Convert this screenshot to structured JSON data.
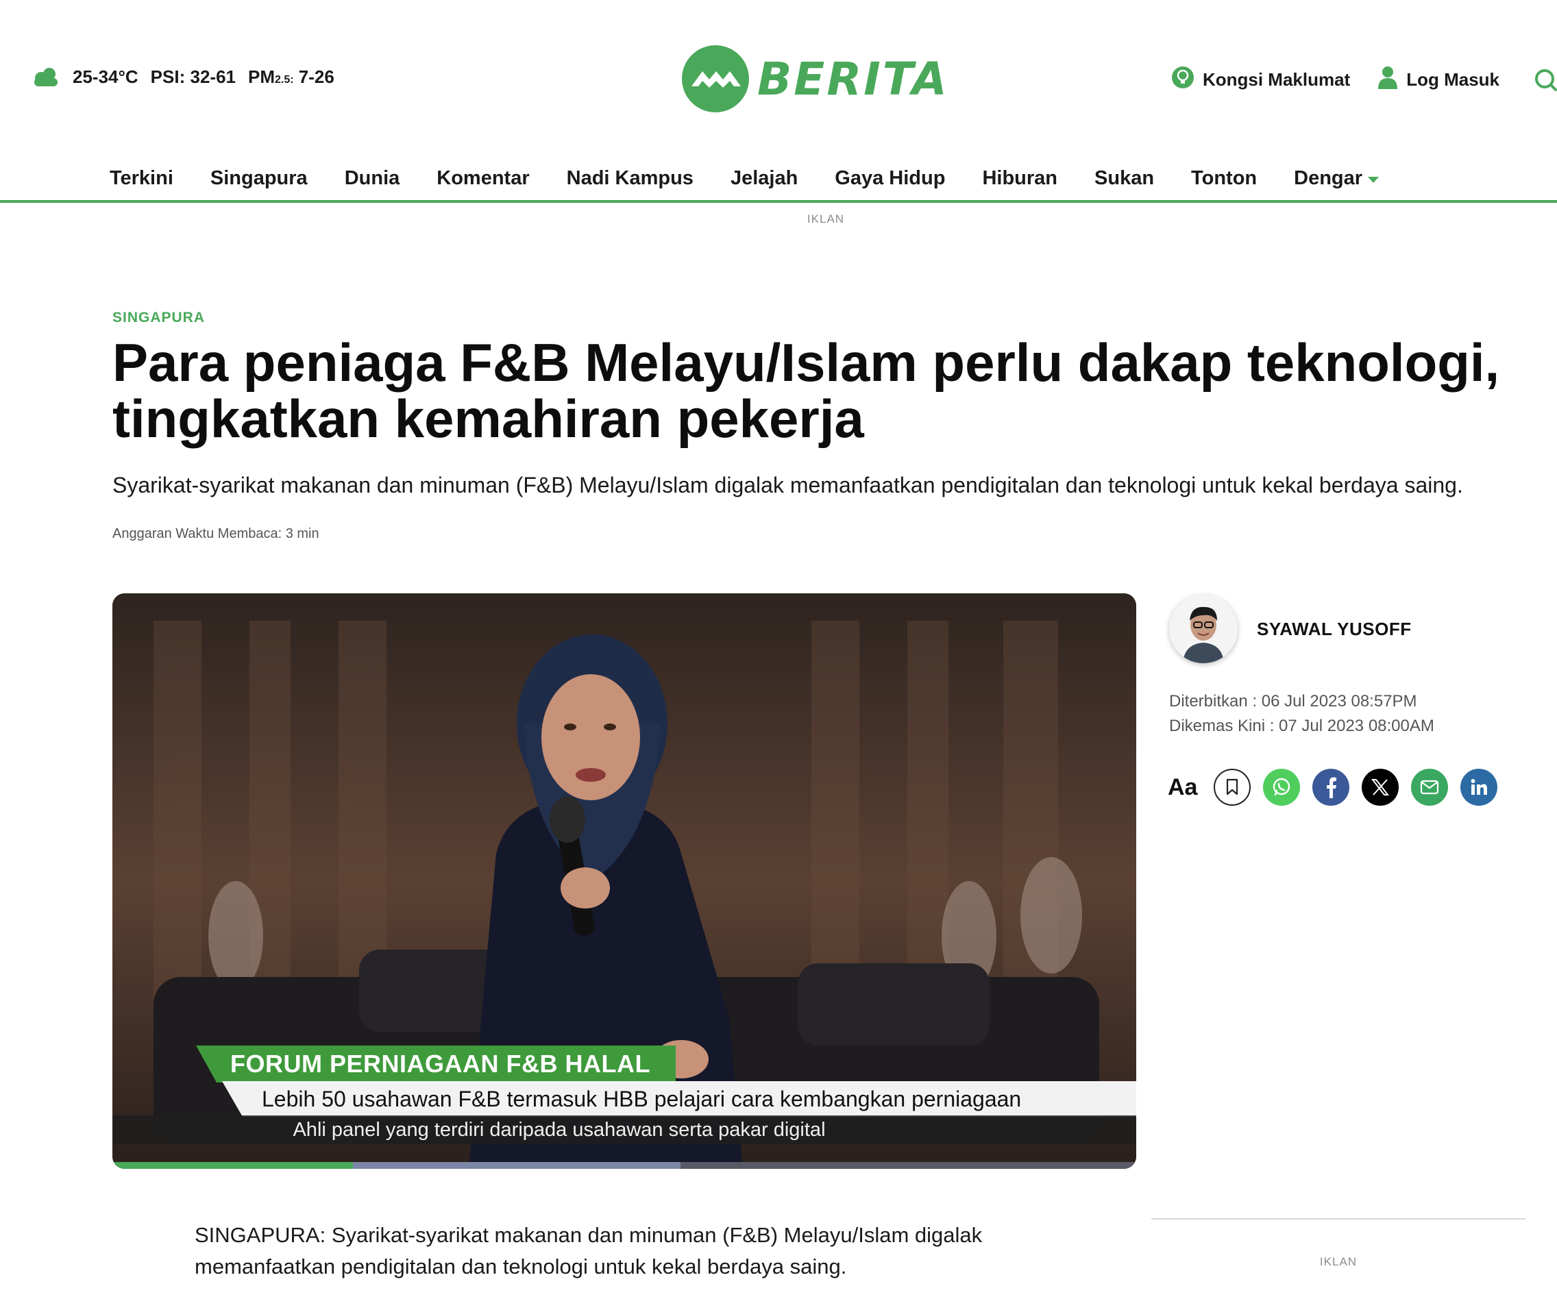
{
  "weather": {
    "temp": "25-34°C",
    "psi_label": "PSI:",
    "psi_value": "32-61",
    "pm_label": "PM",
    "pm_sub": "2.5:",
    "pm_value": "7-26"
  },
  "brand": {
    "name": "BERITA",
    "color": "#4aa85a"
  },
  "header_links": {
    "share_info": "Kongsi Maklumat",
    "login": "Log Masuk"
  },
  "nav": {
    "items": [
      "Terkini",
      "Singapura",
      "Dunia",
      "Komentar",
      "Nadi Kampus",
      "Jelajah",
      "Gaya Hidup",
      "Hiburan",
      "Sukan",
      "Tonton",
      "Dengar"
    ]
  },
  "ads": {
    "top_label": "IKLAN",
    "side_label": "IKLAN"
  },
  "article": {
    "section": "SINGAPURA",
    "headline": "Para peniaga F&B Melayu/Islam perlu dakap teknologi, tingkatkan kemahiran pekerja",
    "standfirst": "Syarikat-syarikat makanan dan minuman (F&B) Melayu/Islam digalak memanfaatkan pendigitalan dan teknologi untuk kekal berdaya saing.",
    "reading_time": "Anggaran Waktu Membaca: 3 min",
    "lead": "SINGAPURA: Syarikat-syarikat makanan dan minuman (F&B) Melayu/Islam digalak memanfaatkan pendigitalan dan teknologi untuk kekal berdaya saing."
  },
  "video": {
    "lower_third_title": "FORUM PERNIAGAAN F&B HALAL",
    "lower_third_subtitle": "Lebih 50 usahawan F&B termasuk HBB pelajari cara kembangkan perniagaan",
    "caption": "Ahli panel yang terdiri daripada usahawan serta pakar digital",
    "progress_played": 0.235,
    "progress_buffered_end": 0.555
  },
  "author": {
    "name": "SYAWAL YUSOFF",
    "published": "Diterbitkan : 06 Jul 2023 08:57PM",
    "updated": "Dikemas Kini : 07 Jul 2023 08:00AM"
  },
  "share": {
    "font_size_label": "Aa",
    "icons": [
      "bookmark-icon",
      "whatsapp-icon",
      "facebook-icon",
      "x-icon",
      "email-icon",
      "linkedin-icon"
    ],
    "colors": {
      "whatsapp": "#4fce5d",
      "facebook": "#3b5998",
      "x": "#000000",
      "email": "#3aa860",
      "linkedin": "#2b6aa3"
    }
  }
}
